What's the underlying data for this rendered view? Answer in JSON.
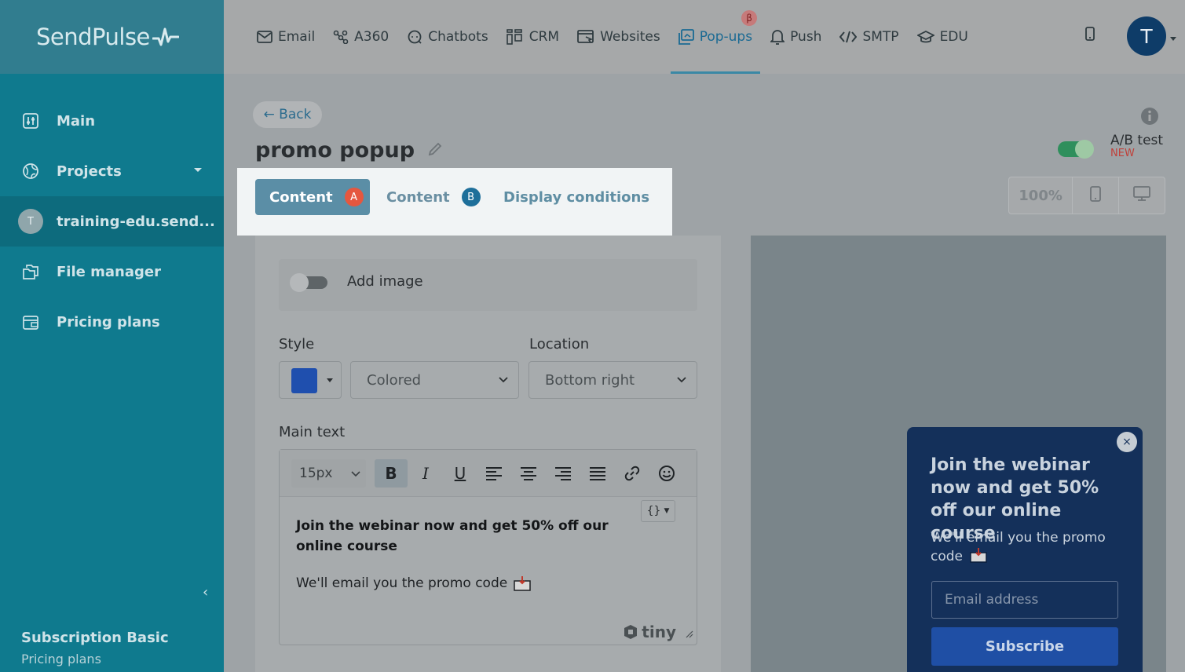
{
  "app": {
    "logo": "SendPulse"
  },
  "sidebar": {
    "items": [
      {
        "label": "Main"
      },
      {
        "label": "Projects"
      },
      {
        "label": "training-edu.send...",
        "avatar": "T"
      },
      {
        "label": "File manager"
      },
      {
        "label": "Pricing plans"
      }
    ],
    "subscription_title": "Subscription Basic",
    "subscription_link": "Pricing plans"
  },
  "topnav": {
    "items": [
      {
        "label": "Email"
      },
      {
        "label": "A360"
      },
      {
        "label": "Chatbots"
      },
      {
        "label": "CRM"
      },
      {
        "label": "Websites"
      },
      {
        "label": "Pop-ups",
        "badge": "β"
      },
      {
        "label": "Push"
      },
      {
        "label": "SMTP"
      },
      {
        "label": "EDU"
      }
    ],
    "user_initial": "T"
  },
  "page": {
    "back_label": "← Back",
    "title": "promo popup",
    "ab_test_label": "A/B test",
    "ab_test_badge": "NEW",
    "tabs": [
      {
        "label": "Content",
        "badge": "A"
      },
      {
        "label": "Content",
        "badge": "B"
      },
      {
        "label": "Display conditions"
      }
    ],
    "zoom": "100%"
  },
  "editor": {
    "add_image_label": "Add image",
    "style_label": "Style",
    "location_label": "Location",
    "style_value": "Colored",
    "location_value": "Bottom right",
    "style_color": "#1f4fae",
    "main_text_label": "Main text",
    "font_size": "15px",
    "variable_button": "{}",
    "content_bold": "Join the webinar now and get 50% off our online course",
    "content_text": "We'll email you the promo code",
    "brand": "tiny"
  },
  "preview": {
    "close": "×",
    "title": "Join the webinar now and get 50% off our online course",
    "text": "We'll email you the promo code",
    "email_placeholder": "Email address",
    "button_label": "Subscribe"
  }
}
